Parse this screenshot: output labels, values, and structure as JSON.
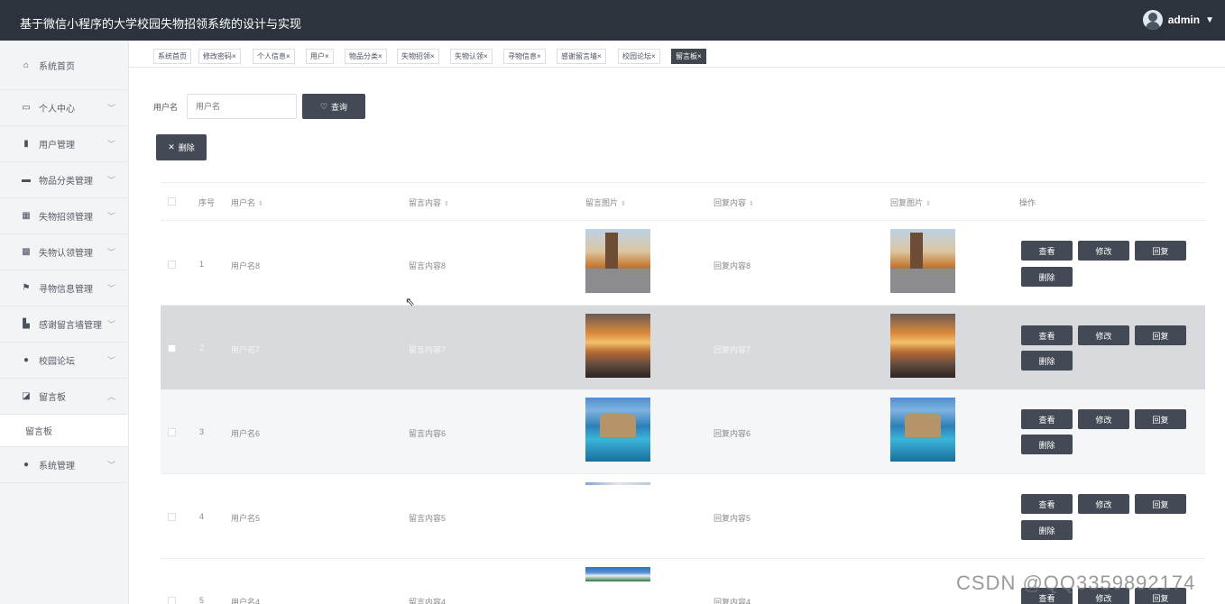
{
  "app": {
    "title": "基于微信小程序的大学校园失物招领系统的设计与实现",
    "user": "admin"
  },
  "sidebar": {
    "items": [
      {
        "label": "系统首页",
        "icon": "home-icon"
      },
      {
        "label": "个人中心",
        "icon": "profile-icon"
      },
      {
        "label": "用户管理",
        "icon": "chart-icon"
      },
      {
        "label": "物品分类管理",
        "icon": "card-icon"
      },
      {
        "label": "失物招领管理",
        "icon": "grid-icon"
      },
      {
        "label": "失物认领管理",
        "icon": "table-icon"
      },
      {
        "label": "寻物信息管理",
        "icon": "flag-icon"
      },
      {
        "label": "感谢留言墙管理",
        "icon": "bar-icon"
      },
      {
        "label": "校园论坛",
        "icon": "pin-icon"
      },
      {
        "label": "留言板",
        "icon": "chart-box-icon"
      },
      {
        "label": "留言板",
        "icon": ""
      },
      {
        "label": "系统管理",
        "icon": "user-icon"
      }
    ]
  },
  "tags": [
    "系统首页",
    "修改密码",
    "个人信息",
    "用户",
    "物品分类",
    "失物招领",
    "失物认领",
    "寻物信息",
    "感谢留言墙",
    "校园论坛",
    "留言板"
  ],
  "tag_close": "×",
  "search": {
    "label": "用户名",
    "placeholder": "用户名",
    "button": "查询"
  },
  "toolbar": {
    "delete_label": "删除"
  },
  "table": {
    "headers": {
      "index": "序号",
      "username": "用户名",
      "content": "留言内容",
      "image": "留言图片",
      "reply": "回复内容",
      "reply_image": "回复图片",
      "actions": "操作"
    },
    "rows": [
      {
        "index": "1",
        "username": "用户名8",
        "content": "留言内容8",
        "reply": "回复内容8"
      },
      {
        "index": "2",
        "username": "用户名7",
        "content": "留言内容7",
        "reply": "回复内容7"
      },
      {
        "index": "3",
        "username": "用户名6",
        "content": "留言内容6",
        "reply": "回复内容6"
      },
      {
        "index": "4",
        "username": "用户名5",
        "content": "留言内容5",
        "reply": "回复内容5"
      },
      {
        "index": "5",
        "username": "用户名4",
        "content": "留言内容4",
        "reply": "回复内容4"
      }
    ],
    "actions": {
      "view": "查看",
      "edit": "修改",
      "reply": "回复",
      "delete": "删除"
    }
  },
  "watermark": "CSDN @QQ3359892174",
  "colors": {
    "header_bg": "#2c333d",
    "button_bg": "#434a55",
    "hover_row": "#d9dadd"
  }
}
